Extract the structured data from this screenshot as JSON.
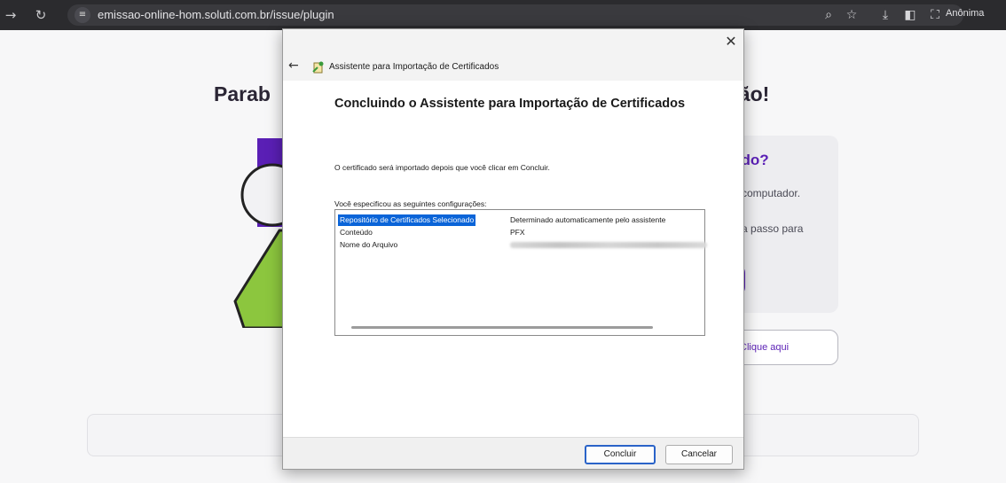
{
  "browser": {
    "url": "emissao-online-hom.soluti.com.br/issue/plugin",
    "profile_label": "Anônima",
    "icons": {
      "forward": "arrow-right-icon",
      "reload": "reload-icon",
      "site_info": "tune-icon",
      "zoom": "zoom-icon",
      "bookmark": "star-icon",
      "download": "download-icon",
      "sidepanel": "side-panel-icon",
      "incognito": "incognito-icon"
    }
  },
  "page": {
    "title_left": "Parab",
    "title_right": "ção!",
    "card_title": "ado?",
    "card_text1": "u computador.",
    "card_text2": "o a passo para",
    "link_label": "Clique aqui",
    "accent_color": "#5a1fb5"
  },
  "dialog": {
    "title": "Assistente para Importação de Certificados",
    "close": "✕",
    "back": "←",
    "heading": "Concluindo o Assistente para Importação de Certificados",
    "message": "O certificado será importado depois que você clicar em Concluir.",
    "specs_label": "Você especificou as seguintes configurações:",
    "rows": [
      {
        "name": "Repositório de Certificados Selecionado",
        "value": "Determinado automaticamente pelo assistente"
      },
      {
        "name": "Conteúdo",
        "value": "PFX"
      },
      {
        "name": "Nome do Arquivo",
        "value": ""
      }
    ],
    "finish_label": "Concluir",
    "cancel_label": "Cancelar"
  }
}
